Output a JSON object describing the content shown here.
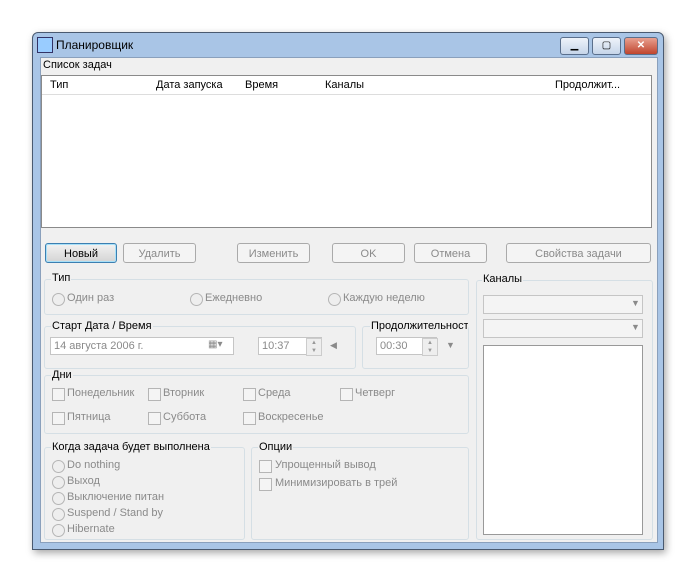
{
  "window": {
    "title": "Планировщик",
    "min": "▁",
    "max": "▢",
    "close": "✕"
  },
  "tasks": {
    "label": "Список задач",
    "columns": [
      "Тип",
      "Дата запуска",
      "Время",
      "Каналы",
      "Продолжит..."
    ]
  },
  "buttons": {
    "new": "Новый",
    "delete": "Удалить",
    "edit": "Изменить",
    "ok": "OK",
    "cancel": "Отмена",
    "props": "Свойства задачи"
  },
  "type": {
    "label": "Тип",
    "options": [
      "Один раз",
      "Ежедневно",
      "Каждую неделю"
    ]
  },
  "start": {
    "label": "Старт Дата / Время",
    "date": "14  августа  2006 г.",
    "time": "10:37"
  },
  "duration": {
    "label": "Продолжительност",
    "value": "00:30"
  },
  "days": {
    "label": "Дни",
    "items": [
      "Понедельник",
      "Вторник",
      "Среда",
      "Четверг",
      "Пятница",
      "Суббота",
      "Воскресенье"
    ]
  },
  "when": {
    "label": "Когда задача будет выполнена",
    "items": [
      "Do nothing",
      "Выход",
      "Выключение питан",
      "Suspend / Stand by",
      "Hibernate"
    ]
  },
  "options": {
    "label": "Опции",
    "items": [
      "Упрощенный вывод",
      "Минимизировать в трей"
    ]
  },
  "channels": {
    "label": "Каналы"
  }
}
